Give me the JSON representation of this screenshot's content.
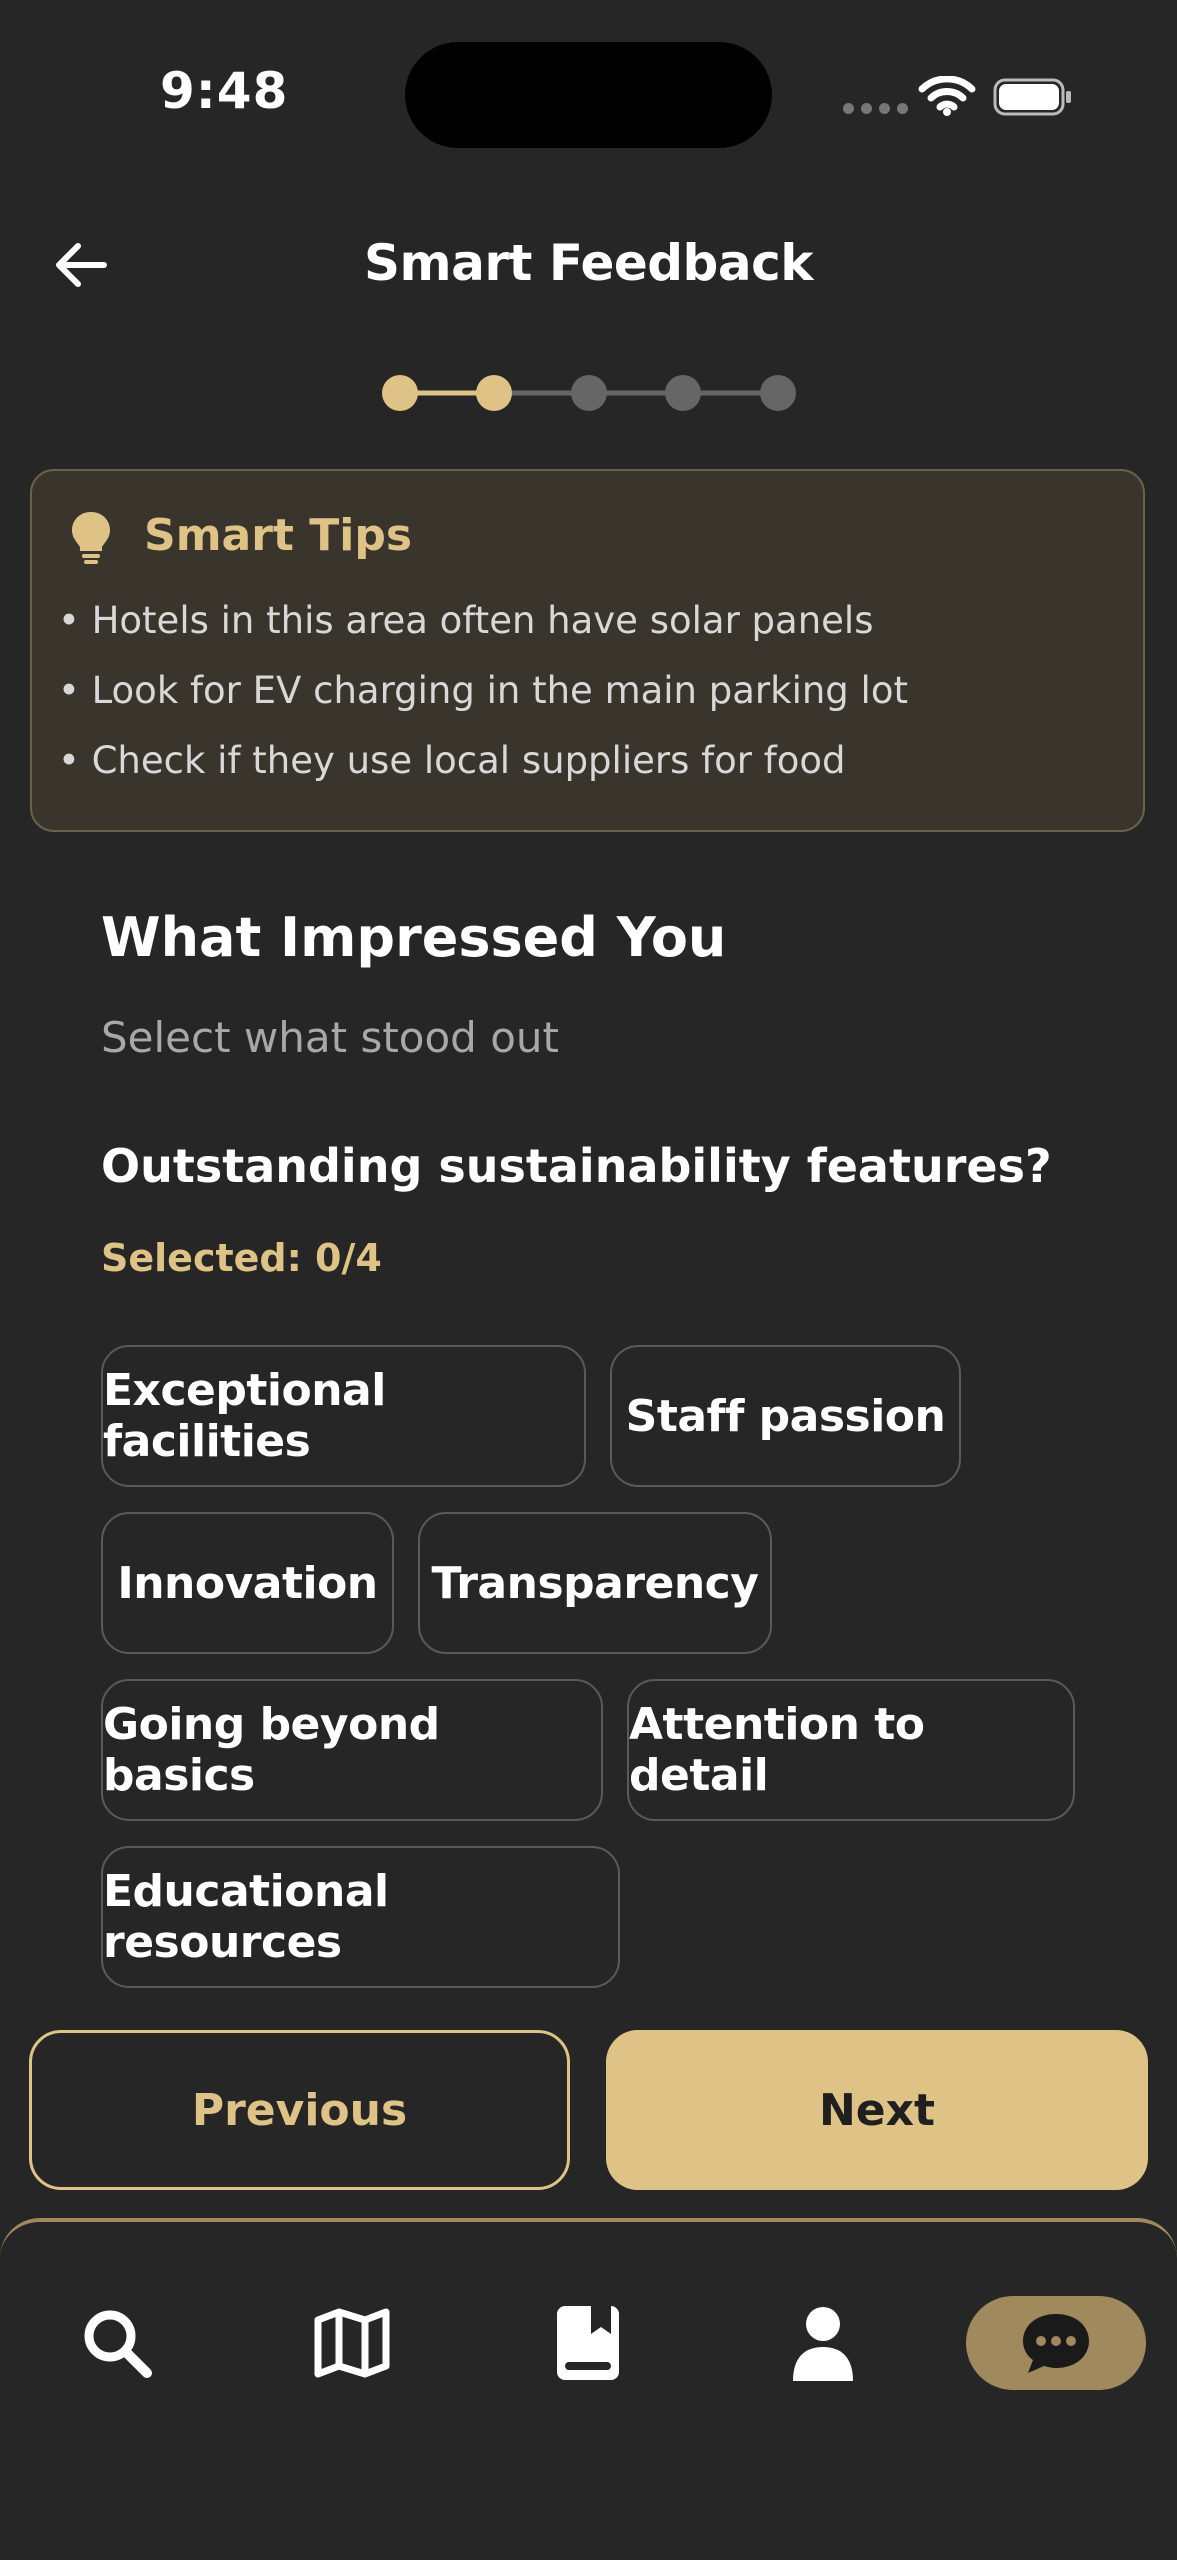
{
  "status_bar": {
    "time": "9:48"
  },
  "header": {
    "title": "Smart Feedback"
  },
  "progress": {
    "total_steps": 5,
    "current_step": 2
  },
  "tips": {
    "title": "Smart Tips",
    "items": [
      "• Hotels in this area often have solar panels",
      "• Look for EV charging in the main parking lot",
      "• Check if they use local suppliers for food"
    ]
  },
  "section": {
    "heading": "What Impressed You",
    "subheading": "Select what stood out",
    "question": "Outstanding sustainability features?",
    "selected_label": "Selected: 0/4"
  },
  "options": [
    "Exceptional facilities",
    "Staff passion",
    "Innovation",
    "Transparency",
    "Going beyond basics",
    "Attention to detail",
    "Educational resources"
  ],
  "buttons": {
    "previous": "Previous",
    "next": "Next"
  },
  "tabbar": {
    "items": [
      "search-icon",
      "map-icon",
      "bookmark-book-icon",
      "profile-icon",
      "chat-icon"
    ],
    "active": 4
  },
  "colors": {
    "accent": "#dfc386",
    "background": "#262626",
    "inactive_step": "#666666",
    "active_tab": "#a0895c"
  }
}
